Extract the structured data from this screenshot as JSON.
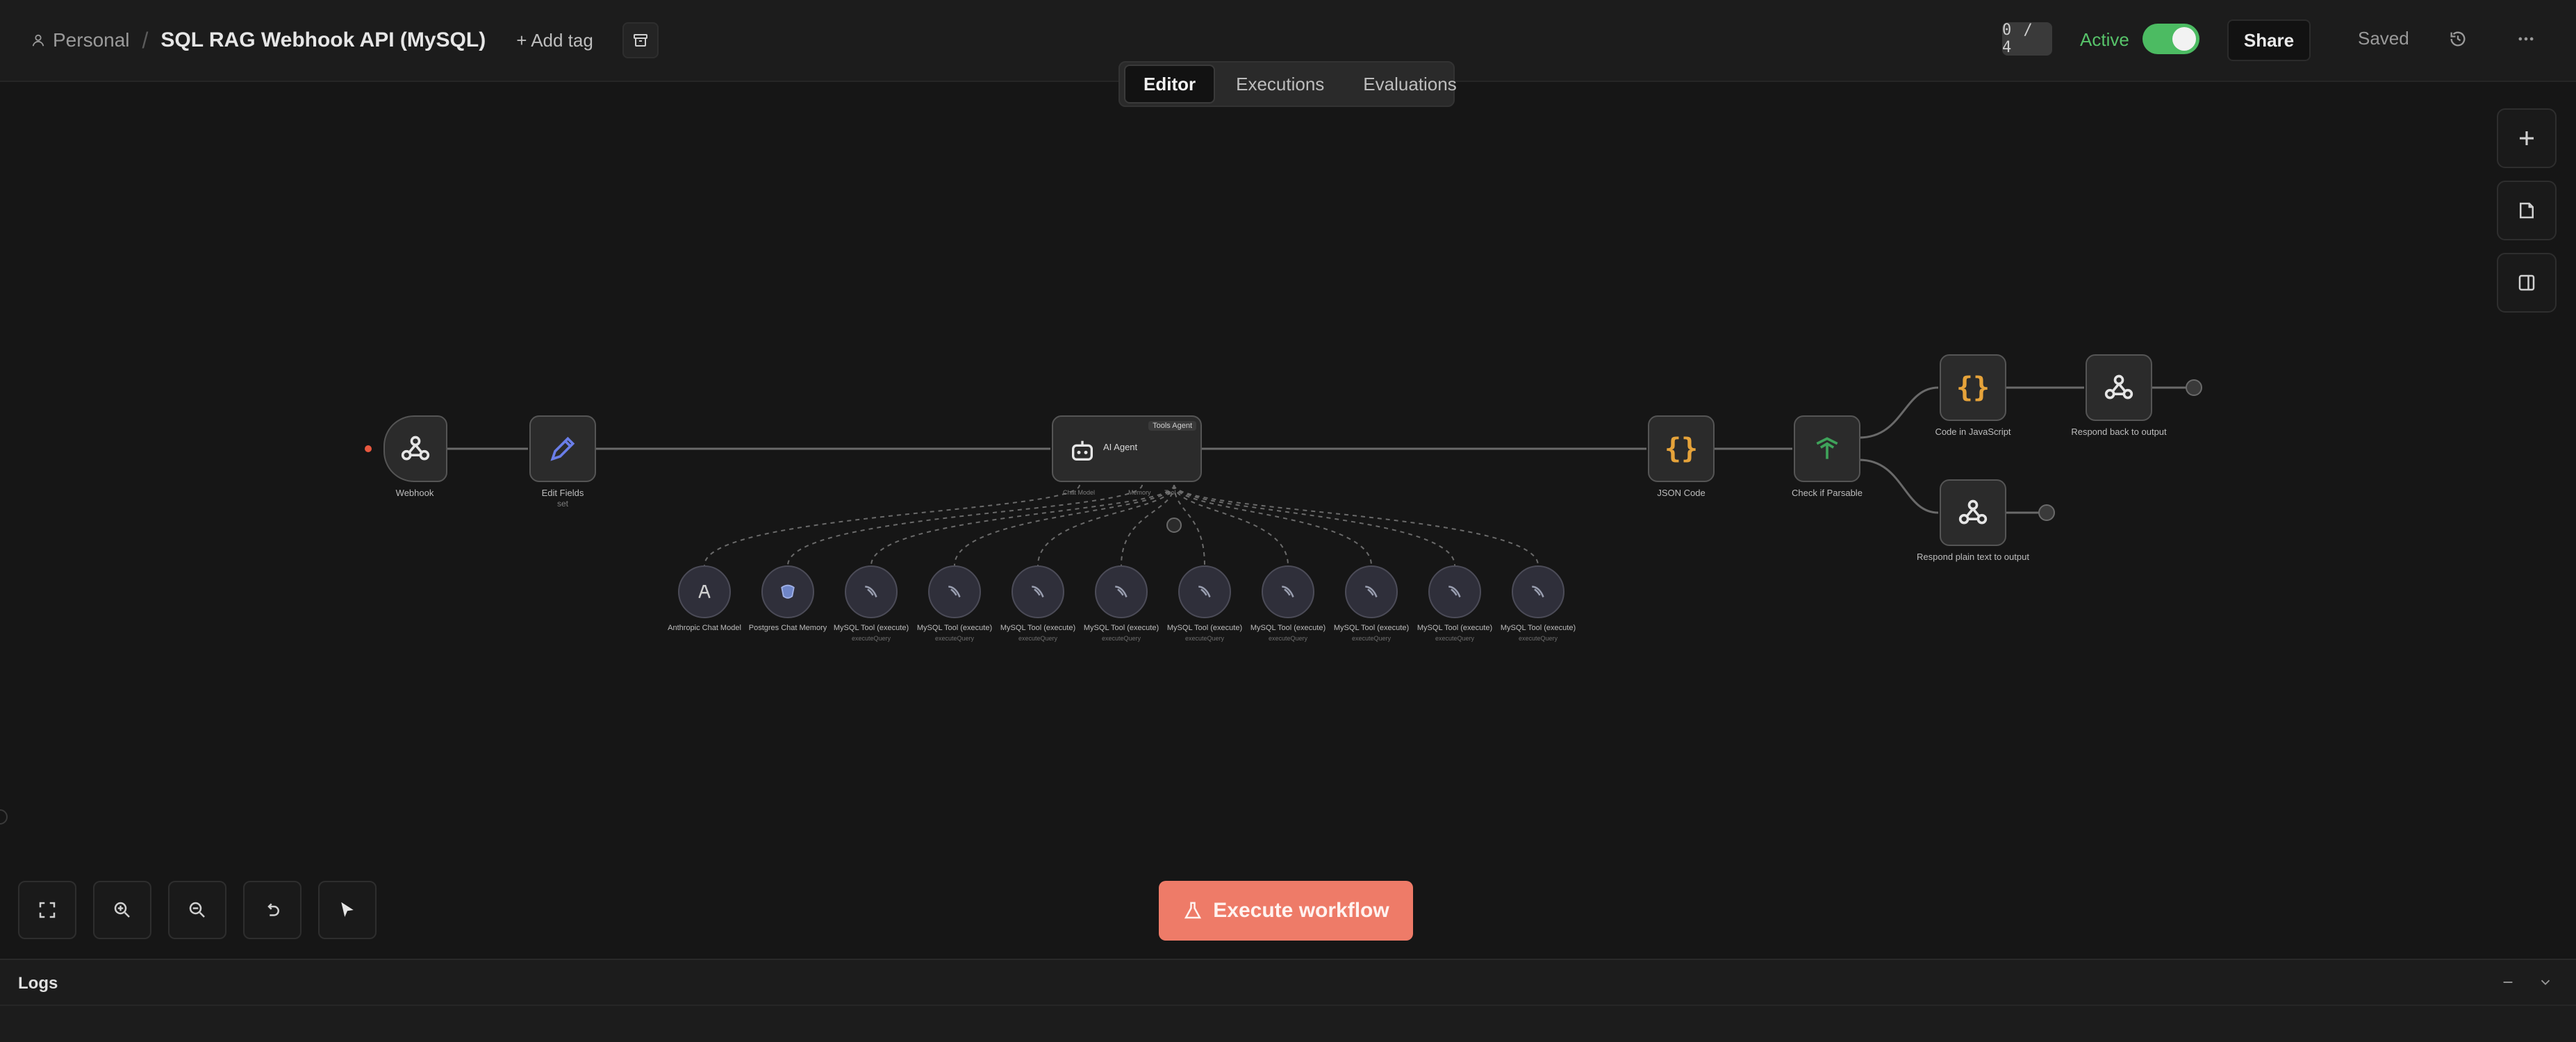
{
  "header": {
    "project": "Personal",
    "separator": "/",
    "workflow_name": "SQL RAG Webhook API (MySQL)",
    "add_tag": "+ Add tag",
    "shortcut_badge": "0 / 4",
    "active_label": "Active",
    "active": true,
    "share_label": "Share",
    "saved_label": "Saved"
  },
  "tabs": [
    {
      "label": "Editor",
      "active": true
    },
    {
      "label": "Executions",
      "active": false
    },
    {
      "label": "Evaluations",
      "active": false
    }
  ],
  "nodes": {
    "webhook": {
      "label": "Webhook"
    },
    "edit_fields": {
      "label": "Edit Fields",
      "sub": "set"
    },
    "ai_agent": {
      "label": "AI Agent",
      "badge": "Tools Agent"
    },
    "json_code": {
      "label": "JSON Code"
    },
    "check_parsable": {
      "label": "Check if Parsable"
    },
    "code_js": {
      "label": "Code in JavaScript"
    },
    "respond_top": {
      "label": "Respond back to output"
    },
    "respond_bottom": {
      "label": "Respond plain text to output"
    }
  },
  "agent_ports": [
    "Chat Model",
    "Memory",
    "Tool"
  ],
  "sub_nodes": [
    {
      "label": "Anthropic Chat Model",
      "sub": "",
      "kind": "model"
    },
    {
      "label": "Postgres Chat Memory",
      "sub": "",
      "kind": "memory"
    },
    {
      "label": "MySQL Tool (execute)",
      "sub": "executeQuery",
      "kind": "tool"
    },
    {
      "label": "MySQL Tool (execute)",
      "sub": "executeQuery",
      "kind": "tool"
    },
    {
      "label": "MySQL Tool (execute)",
      "sub": "executeQuery",
      "kind": "tool"
    },
    {
      "label": "MySQL Tool (execute)",
      "sub": "executeQuery",
      "kind": "tool"
    },
    {
      "label": "MySQL Tool (execute)",
      "sub": "executeQuery",
      "kind": "tool"
    },
    {
      "label": "MySQL Tool (execute)",
      "sub": "executeQuery",
      "kind": "tool"
    },
    {
      "label": "MySQL Tool (execute)",
      "sub": "executeQuery",
      "kind": "tool"
    },
    {
      "label": "MySQL Tool (execute)",
      "sub": "executeQuery",
      "kind": "tool"
    },
    {
      "label": "MySQL Tool (execute)",
      "sub": "executeQuery",
      "kind": "tool"
    }
  ],
  "execute_button": "Execute workflow",
  "logs": {
    "title": "Logs"
  },
  "colors": {
    "accent": "#ee7b68",
    "active_green": "#4cbb62",
    "code_orange": "#e6a33a",
    "edit_blue": "#6a7ee8",
    "if_green": "#3fa35a"
  },
  "icons": {
    "user": "user-icon",
    "archive": "archive-icon",
    "history": "history-icon",
    "more": "more-horizontal-icon",
    "plus": "plus-icon",
    "sticky": "sticky-note-icon",
    "panel": "panel-toggle-icon",
    "fit": "fit-view-icon",
    "zoom_in": "zoom-in-icon",
    "zoom_out": "zoom-out-icon",
    "undo": "undo-icon",
    "pointer": "pointer-icon",
    "flask": "flask-icon"
  }
}
